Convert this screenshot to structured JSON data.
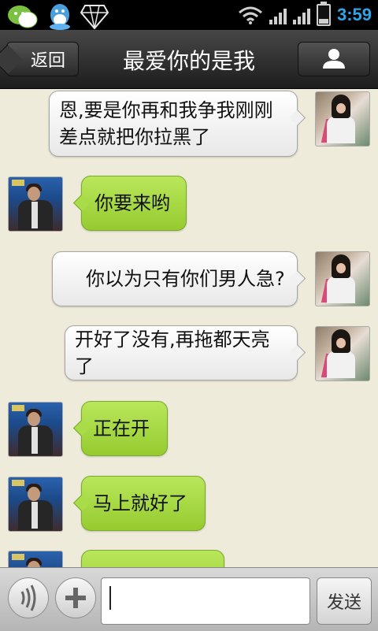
{
  "status_bar": {
    "time": "3:59",
    "battery_level": "23",
    "battery_fraction": 0.23,
    "time_color": "#2ea5e8"
  },
  "header": {
    "back_label": "返回",
    "title": "最爱你的是我"
  },
  "messages": [
    {
      "sender": "her",
      "text": "恩,要是你再和我争我刚刚差点就把你拉黑了"
    },
    {
      "sender": "him",
      "text": "你要来哟"
    },
    {
      "sender": "her",
      "text": "你以为只有你们男人急?"
    },
    {
      "sender": "her",
      "text": "开好了没有,再拖都天亮了"
    },
    {
      "sender": "him",
      "text": "正在开"
    },
    {
      "sender": "him",
      "text": "马上就好了"
    },
    {
      "sender": "him",
      "text": ""
    }
  ],
  "composer": {
    "input_value": "",
    "send_label": "发送"
  },
  "colors": {
    "chat_background": "#efebda",
    "green_bubble": "#a8dc48",
    "white_bubble": "#f5f5f5"
  }
}
